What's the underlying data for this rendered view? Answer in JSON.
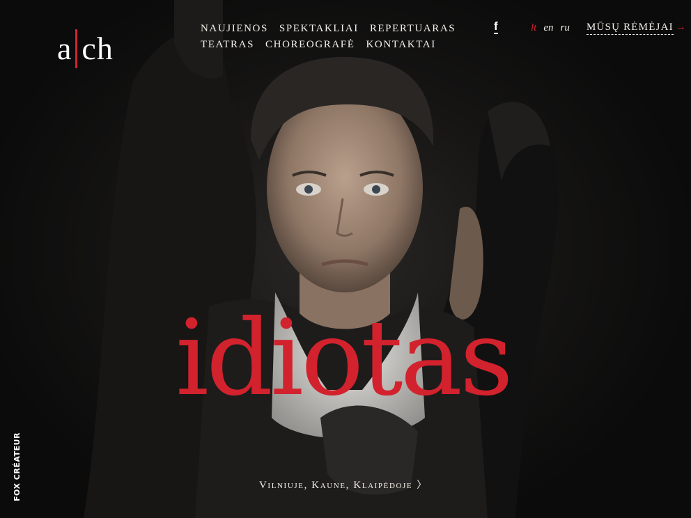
{
  "logo": {
    "left": "a",
    "right": "ch"
  },
  "nav": {
    "row1": [
      {
        "label": "NAUJIENOS"
      },
      {
        "label": "SPEKTAKLIAI"
      },
      {
        "label": "REPERTUARAS"
      }
    ],
    "row2": [
      {
        "label": "TEATRAS"
      },
      {
        "label": "CHOREOGRAFĖ"
      },
      {
        "label": "KONTAKTAI"
      }
    ]
  },
  "social": {
    "facebook": "f"
  },
  "languages": {
    "lt": "lt",
    "en": "en",
    "ru": "ru",
    "active": "lt"
  },
  "sponsors": {
    "label": "MŪSŲ RĖMĖJAI",
    "arrow": "→"
  },
  "hero": {
    "title": "idiotas",
    "cities": "Vilniuje, Kaune, Klaipėdoje",
    "chevron": "〉"
  },
  "footer": {
    "credit": "FOX CRÉATEUR"
  },
  "colors": {
    "accent": "#d2222d",
    "background": "#0d0d0d",
    "text": "#f0ece4"
  },
  "icons": {
    "facebook": "facebook-icon",
    "arrow": "arrow-right-icon",
    "chevron": "chevron-right-icon"
  }
}
